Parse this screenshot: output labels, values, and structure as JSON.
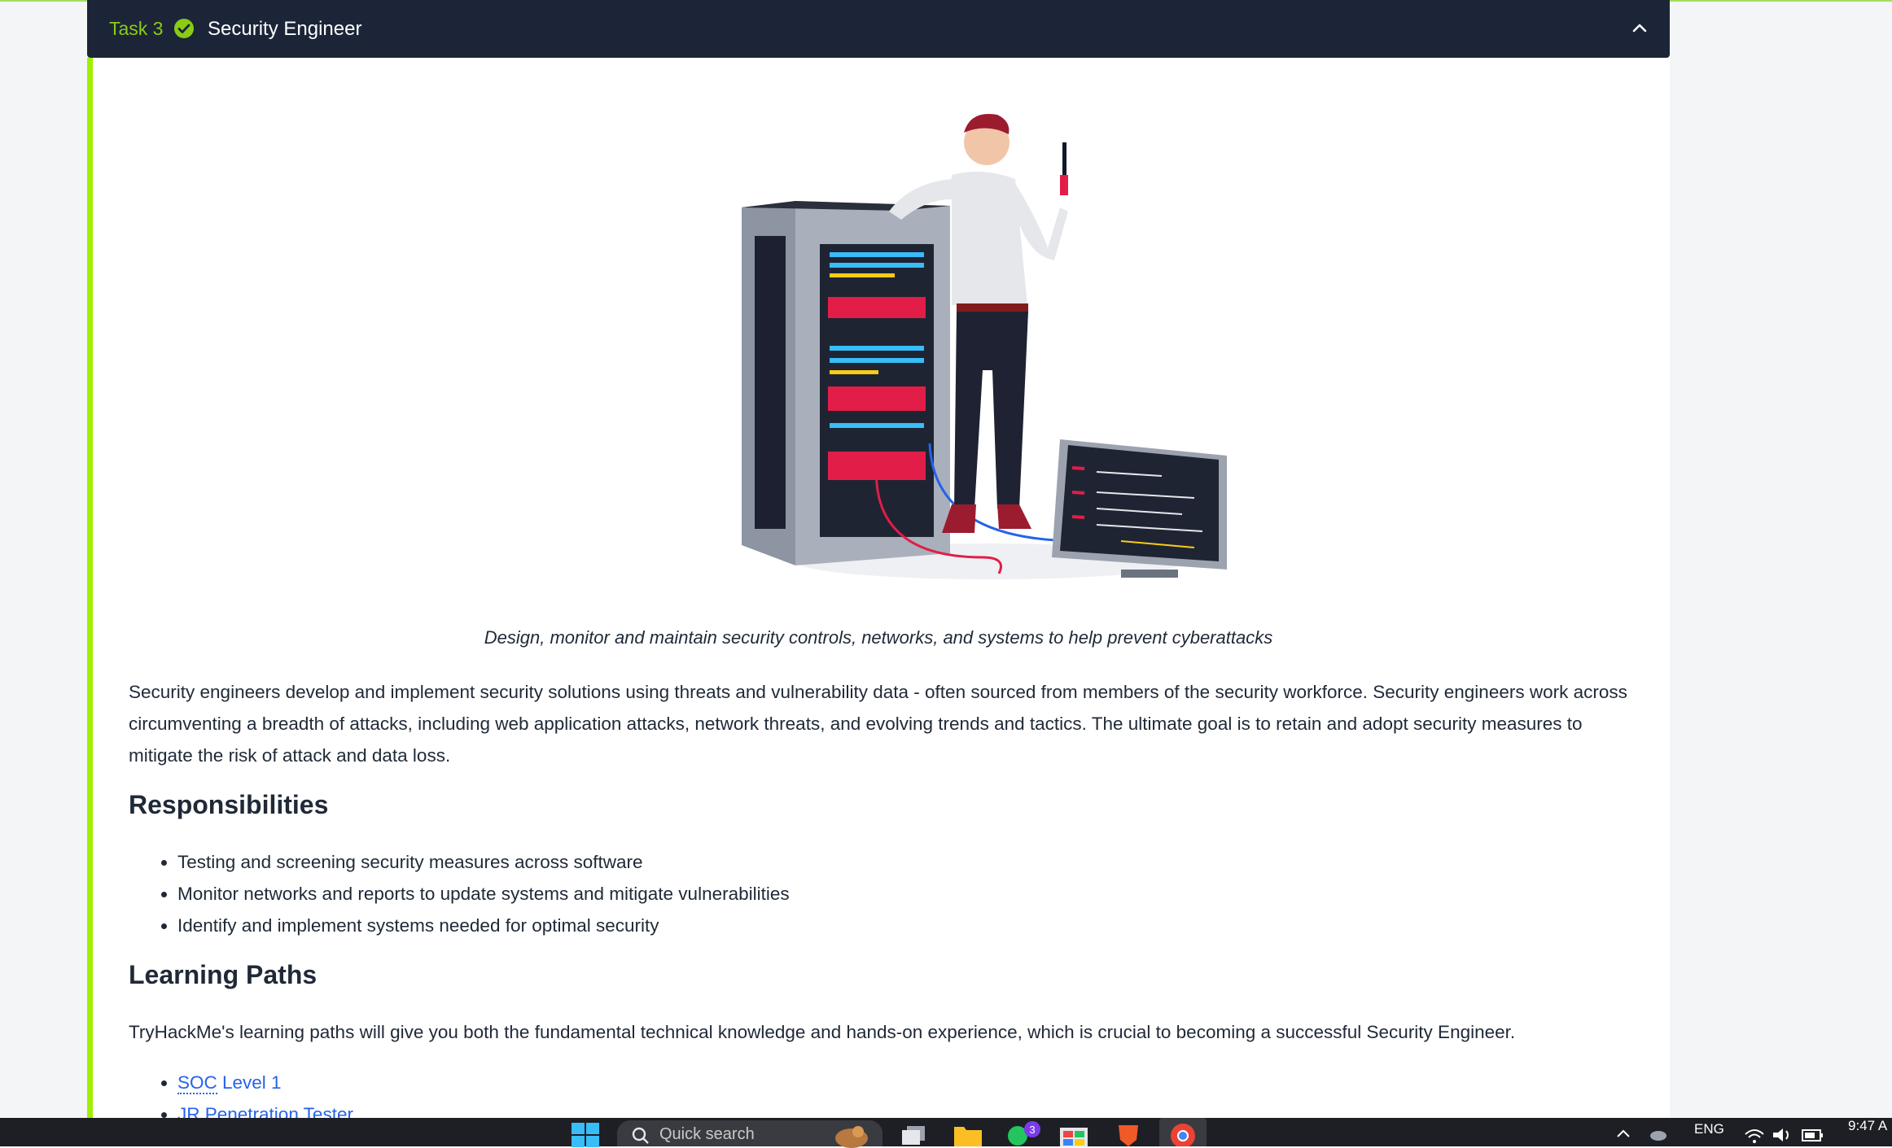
{
  "task": {
    "label": "Task 3",
    "title": "Security Engineer",
    "status_icon": "check-circle-icon",
    "toggle_icon": "chevron-up-icon",
    "accent_color": "#9fef00",
    "header_bg": "#1c2538"
  },
  "content": {
    "caption": "Design, monitor and maintain security controls, networks, and systems to help prevent cyberattacks",
    "intro_line1": "Security engineers develop and implement security solutions using threats and vulnerability data - often sourced from members of the security workforce. Security engineers work across",
    "intro_line2": "circumventing a breadth of attacks, including web application attacks, network threats, and evolving trends and tactics. The ultimate goal is to retain and adopt security measures to",
    "intro_line3": "mitigate the risk of attack and data loss.",
    "responsibilities_heading": "Responsibilities",
    "responsibilities": [
      "Testing and screening security measures across software",
      "Monitor networks and reports to update systems and mitigate vulnerabilities",
      "Identify and implement systems needed for optimal security"
    ],
    "learning_heading": "Learning Paths",
    "learning_text": "TryHackMe's learning paths will give you both the fundamental technical knowledge and hands-on experience, which is crucial to becoming a successful Security Engineer.",
    "paths": [
      {
        "abbr": "SOC",
        "rest": " Level 1"
      },
      {
        "abbr": "JR",
        "rest": " Penetration Tester"
      }
    ]
  },
  "taskbar": {
    "search_placeholder": "Quick search",
    "notification_count": "3",
    "language": "ENG",
    "time": "9:47 A"
  }
}
